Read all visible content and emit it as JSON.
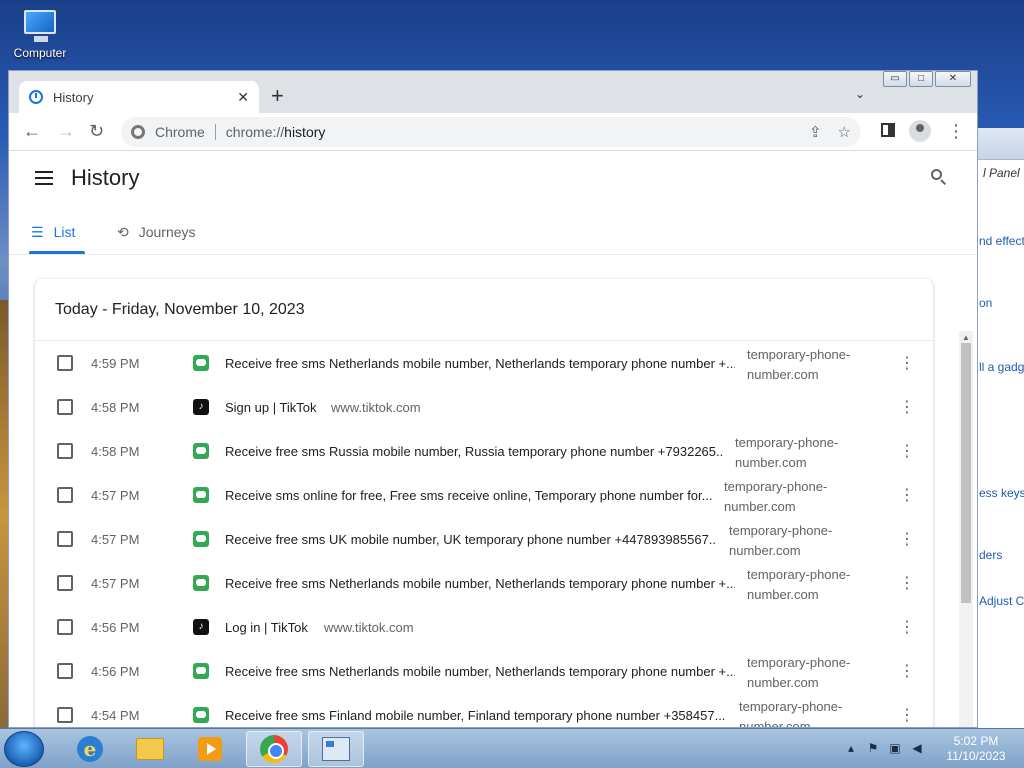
{
  "desktop": {
    "computer_label": "Computer"
  },
  "background_window": {
    "title_fragment": "l Panel",
    "links": [
      "nd effects",
      "on",
      "ll a gadg",
      "ess keys",
      "ders",
      "Adjust C"
    ]
  },
  "browser": {
    "tab_title": "History",
    "new_tab_symbol": "+",
    "tab_close_symbol": "✕",
    "tab_list_symbol": "⌄",
    "omnibox": {
      "chip": "Chrome",
      "scheme": "chrome://",
      "host": "history"
    },
    "window_controls": [
      "▭",
      "□",
      "✕"
    ]
  },
  "history": {
    "title": "History",
    "tabs": [
      {
        "label": "List",
        "active": true
      },
      {
        "label": "Journeys",
        "active": false
      }
    ],
    "date_header": "Today - Friday, November 10, 2023",
    "entries": [
      {
        "time": "4:59 PM",
        "favicon": "sms-icon",
        "title": "Receive free sms Netherlands mobile number, Netherlands temporary phone number +...",
        "domain": "temporary-phone-number.com"
      },
      {
        "time": "4:58 PM",
        "favicon": "tiktok-icon",
        "title": "Sign up | TikTok",
        "domain": "www.tiktok.com"
      },
      {
        "time": "4:58 PM",
        "favicon": "sms-icon",
        "title": "Receive free sms Russia mobile number, Russia temporary phone number +7932265...",
        "domain": "temporary-phone-number.com"
      },
      {
        "time": "4:57 PM",
        "favicon": "sms-icon",
        "title": "Receive sms online for free, Free sms receive online, Temporary phone number for...",
        "domain": "temporary-phone-number.com"
      },
      {
        "time": "4:57 PM",
        "favicon": "sms-icon",
        "title": "Receive free sms UK mobile number, UK temporary phone number +447893985567...",
        "domain": "temporary-phone-number.com"
      },
      {
        "time": "4:57 PM",
        "favicon": "sms-icon",
        "title": "Receive free sms Netherlands mobile number, Netherlands temporary phone number +...",
        "domain": "temporary-phone-number.com"
      },
      {
        "time": "4:56 PM",
        "favicon": "tiktok-icon",
        "title": "Log in | TikTok",
        "domain": "www.tiktok.com"
      },
      {
        "time": "4:56 PM",
        "favicon": "sms-icon",
        "title": "Receive free sms Netherlands mobile number, Netherlands temporary phone number +...",
        "domain": "temporary-phone-number.com"
      },
      {
        "time": "4:54 PM",
        "favicon": "sms-icon",
        "title": "Receive free sms Finland mobile number, Finland temporary phone number +358457...",
        "domain": "temporary-phone-number.com"
      }
    ]
  },
  "taskbar": {
    "clock_time": "5:02 PM",
    "clock_date": "11/10/2023"
  },
  "colors": {
    "accent": "#1a73e8",
    "sms_favicon": "#34a853"
  }
}
